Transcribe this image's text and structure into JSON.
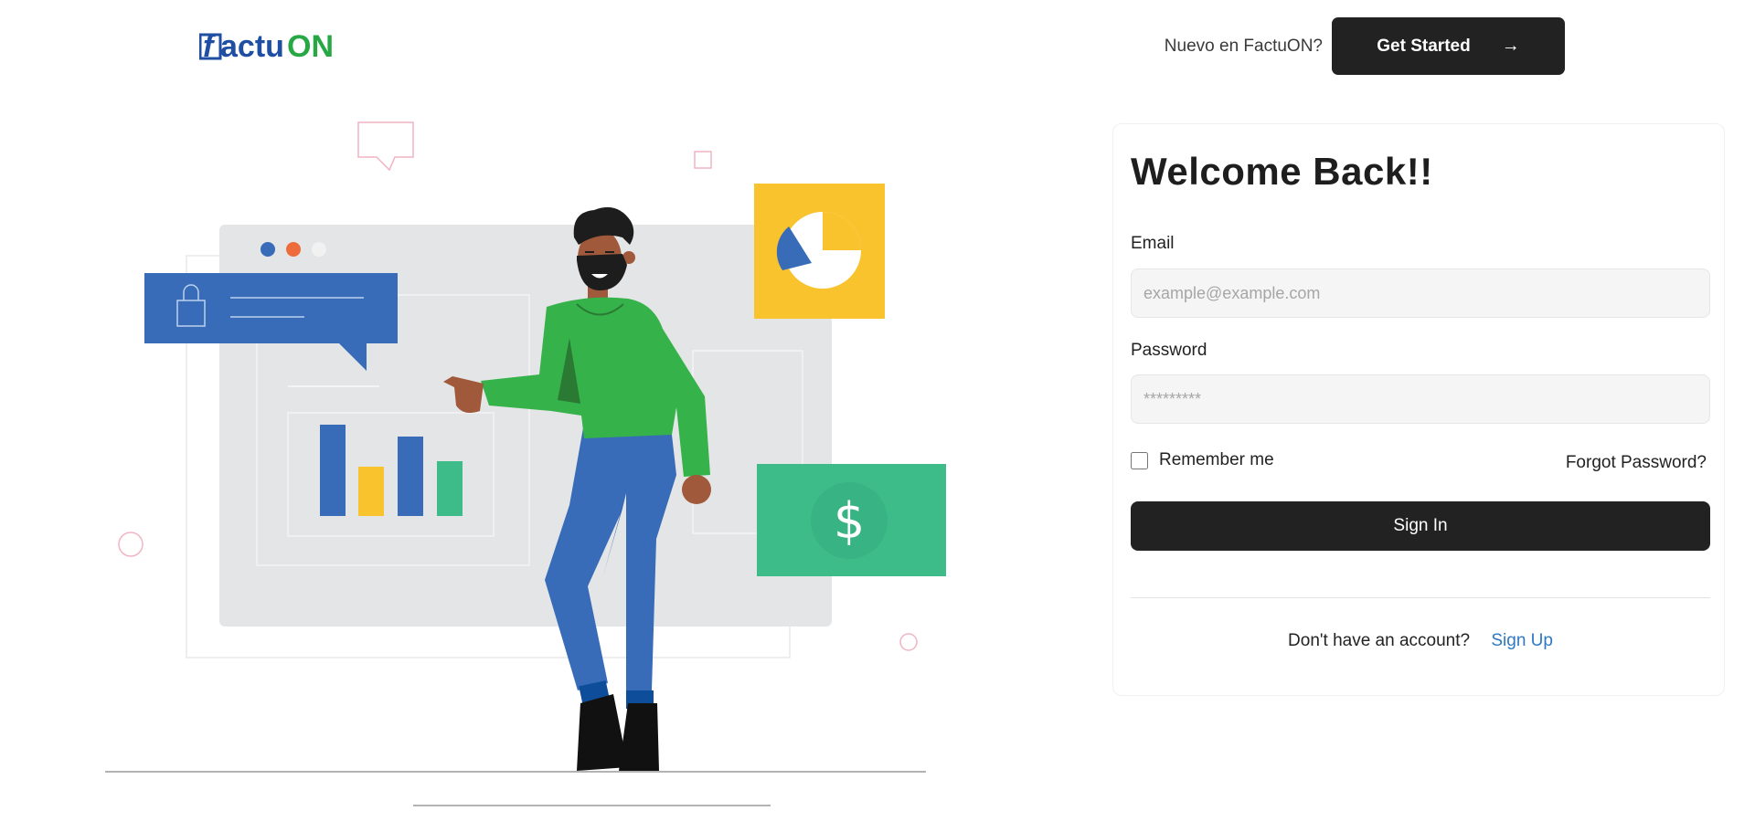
{
  "brand": {
    "logo_text_prefix": "f",
    "logo_text_mid": "actu",
    "logo_text_suffix": "ON"
  },
  "header": {
    "prompt": "Nuevo en FactuON?",
    "cta_label": "Get Started",
    "cta_icon": "arrow-right-icon"
  },
  "login": {
    "title": "Welcome Back!!",
    "email_label": "Email",
    "email_placeholder": "example@example.com",
    "email_value": "",
    "password_label": "Password",
    "password_placeholder": "*********",
    "password_value": "",
    "remember_label": "Remember me",
    "remember_checked": false,
    "forgot_label": "Forgot Password?",
    "submit_label": "Sign In",
    "signup_prompt": "Don't have an account?",
    "signup_link": "Sign Up"
  },
  "illustration": {
    "currency_symbol": "$"
  },
  "colors": {
    "dark": "#222222",
    "link": "#2e79c4",
    "logo_blue": "#1f4ea3",
    "logo_green": "#27a844",
    "illus_blue": "#386cb8",
    "illus_yellow": "#f9c32e",
    "illus_green": "#3dbc8a",
    "shirt_green": "#35b34a"
  }
}
